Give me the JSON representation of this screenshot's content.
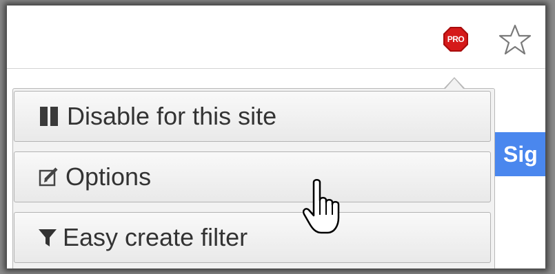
{
  "extension": {
    "badge_text": "PRO",
    "badge_color": "#cc1010",
    "icon": "pro-stop-sign-icon"
  },
  "bookmark": {
    "icon": "star-outline-icon"
  },
  "page": {
    "button_label": "Sig",
    "button_color": "#4a87ee"
  },
  "menu": {
    "items": [
      {
        "label": "Disable for this site",
        "icon": "pause-icon"
      },
      {
        "label": "Options",
        "icon": "edit-icon"
      },
      {
        "label": "Easy create filter",
        "icon": "filter-icon"
      }
    ]
  },
  "cursor": {
    "icon": "hand-pointer-icon"
  }
}
